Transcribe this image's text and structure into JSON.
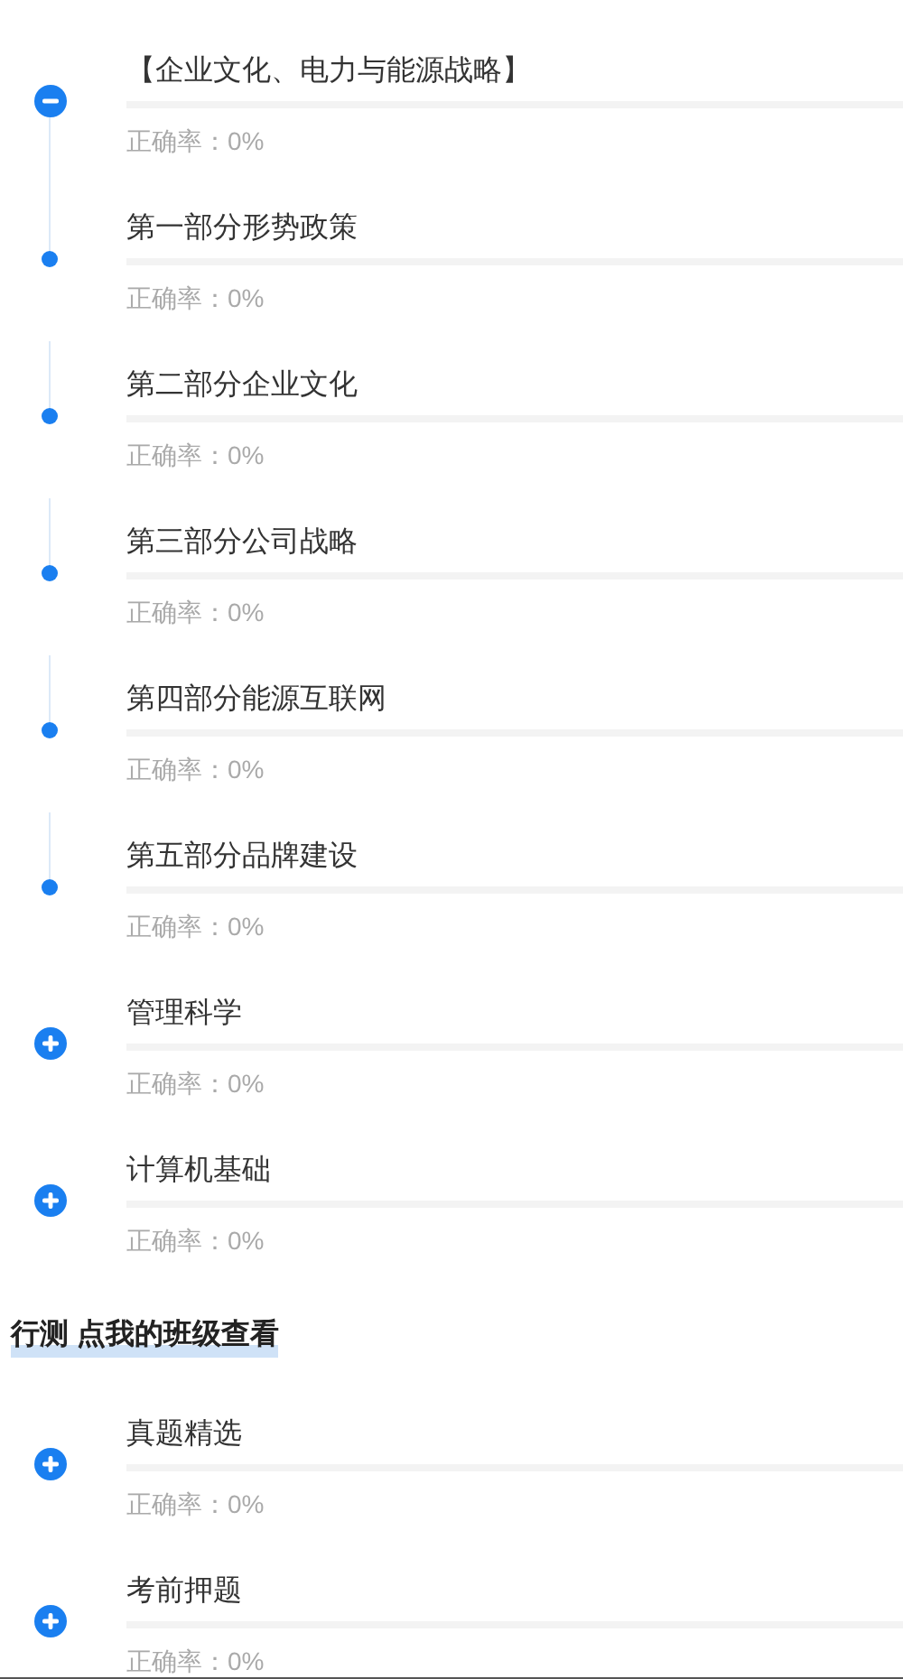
{
  "groups": [
    {
      "items": [
        {
          "title": "【企业文化、电力与能源战略】",
          "level": 0,
          "accuracy": "正确率：0%",
          "expanded": true,
          "children": [
            {
              "title": "第一部分形势政策",
              "level": 0,
              "accuracy": "正确率：0%"
            },
            {
              "title": "第二部分企业文化",
              "level": 0,
              "accuracy": "正确率：0%"
            },
            {
              "title": "第三部分公司战略",
              "level": 0,
              "accuracy": "正确率：0%"
            },
            {
              "title": "第四部分能源互联网",
              "level": 0,
              "accuracy": "正确率：0%"
            },
            {
              "title": "第五部分品牌建设",
              "level": 0,
              "accuracy": "正确率：0%"
            }
          ]
        },
        {
          "title": "管理科学",
          "level": 0,
          "accuracy": "正确率：0%",
          "expanded": false
        },
        {
          "title": "计算机基础",
          "level": 0,
          "accuracy": "正确率：0%",
          "expanded": false
        }
      ]
    },
    {
      "title": "行测 点我的班级查看",
      "items": [
        {
          "title": "真题精选",
          "level": 0,
          "accuracy": "正确率：0%",
          "expanded": false
        },
        {
          "title": "考前押题",
          "level": 0,
          "accuracy": "正确率：0%",
          "expanded": false
        }
      ]
    }
  ]
}
